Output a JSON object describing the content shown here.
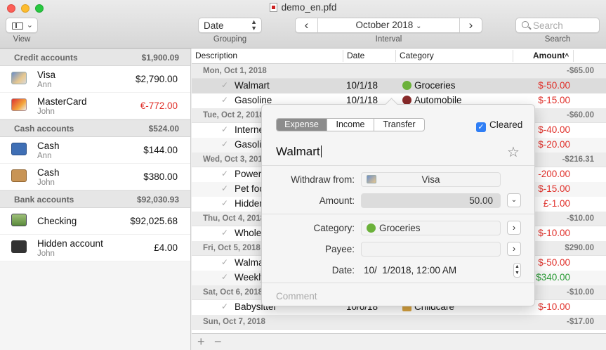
{
  "window": {
    "title": "demo_en.pfd"
  },
  "toolbar": {
    "view_label": "View",
    "grouping_value": "Date",
    "grouping_label": "Grouping",
    "interval_value": "October 2018",
    "interval_label": "Interval",
    "search_placeholder": "Search",
    "search_label": "Search"
  },
  "sidebar": {
    "sections": [
      {
        "name": "Credit accounts",
        "total": "$1,900.09",
        "accounts": [
          {
            "name": "Visa",
            "owner": "Ann",
            "balance": "$2,790.00",
            "icon": "credit-card-icon"
          },
          {
            "name": "MasterCard",
            "owner": "John",
            "balance": "€-772.00",
            "icon": "credit-card-icon"
          }
        ]
      },
      {
        "name": "Cash accounts",
        "total": "$524.00",
        "accounts": [
          {
            "name": "Cash",
            "owner": "Ann",
            "balance": "$144.00",
            "icon": "wallet-icon"
          },
          {
            "name": "Cash",
            "owner": "John",
            "balance": "$380.00",
            "icon": "box-icon"
          }
        ]
      },
      {
        "name": "Bank accounts",
        "total": "$92,030.93",
        "accounts": [
          {
            "name": "Checking",
            "owner": "",
            "balance": "$92,025.68",
            "icon": "checkbook-icon"
          },
          {
            "name": "Hidden account",
            "owner": "John",
            "balance": "£4.00",
            "icon": "spy-icon"
          }
        ]
      }
    ]
  },
  "table": {
    "headers": {
      "description": "Description",
      "date": "Date",
      "category": "Category",
      "amount": "Amount"
    },
    "days": [
      {
        "label": "Mon, Oct 1, 2018",
        "total": "-$65.00",
        "rows": [
          {
            "desc": "Walmart",
            "date": "10/1/18",
            "category": "Groceries",
            "amount": "$-50.00"
          },
          {
            "desc": "Gasoline",
            "date": "10/1/18",
            "category": "Automobile",
            "amount": "$-15.00"
          }
        ]
      },
      {
        "label": "Tue, Oct 2, 2018",
        "total": "-$60.00",
        "rows": [
          {
            "desc": "Internet",
            "date": "",
            "category": "",
            "amount": "$-40.00"
          },
          {
            "desc": "Gasoline",
            "date": "",
            "category": "",
            "amount": "$-20.00"
          }
        ]
      },
      {
        "label": "Wed, Oct 3, 2018",
        "total": "-$216.31",
        "rows": [
          {
            "desc": "Power",
            "date": "",
            "category": "",
            "amount": "-200.00"
          },
          {
            "desc": "Pet food",
            "date": "",
            "category": "",
            "amount": "$-15.00"
          },
          {
            "desc": "Hidden",
            "date": "",
            "category": "",
            "amount": "£-1.00"
          }
        ]
      },
      {
        "label": "Thu, Oct 4, 2018",
        "total": "-$10.00",
        "rows": [
          {
            "desc": "Whole",
            "date": "",
            "category": "",
            "amount": "$-10.00"
          }
        ]
      },
      {
        "label": "Fri, Oct 5, 2018",
        "total": "$290.00",
        "rows": [
          {
            "desc": "Walmart",
            "date": "",
            "category": "",
            "amount": "$-50.00"
          },
          {
            "desc": "Weekly",
            "date": "",
            "category": "",
            "amount": "$340.00"
          }
        ]
      },
      {
        "label": "Sat, Oct 6, 2018",
        "total": "-$10.00",
        "rows": [
          {
            "desc": "Babysitter",
            "date": "10/6/18",
            "category": "Childcare",
            "amount": "$-10.00"
          }
        ]
      },
      {
        "label": "Sun, Oct 7, 2018",
        "total": "-$17.00",
        "rows": []
      }
    ]
  },
  "footer": {
    "add": "+",
    "remove": "−"
  },
  "popover": {
    "tabs": [
      "Expense",
      "Income",
      "Transfer"
    ],
    "cleared_label": "Cleared",
    "payee_title": "Walmart",
    "withdraw_label": "Withdraw from:",
    "withdraw_value": "Visa",
    "amount_label": "Amount:",
    "amount_value": "50.00",
    "category_label": "Category:",
    "category_value": "Groceries",
    "payee_label": "Payee:",
    "payee_value": "",
    "date_label": "Date:",
    "date_value": "10/  1/2018, 12:00 AM",
    "comment_placeholder": "Comment"
  },
  "colors": {
    "negative": "#e0302a",
    "positive": "#2a9a35",
    "accent": "#2f7ef5"
  }
}
